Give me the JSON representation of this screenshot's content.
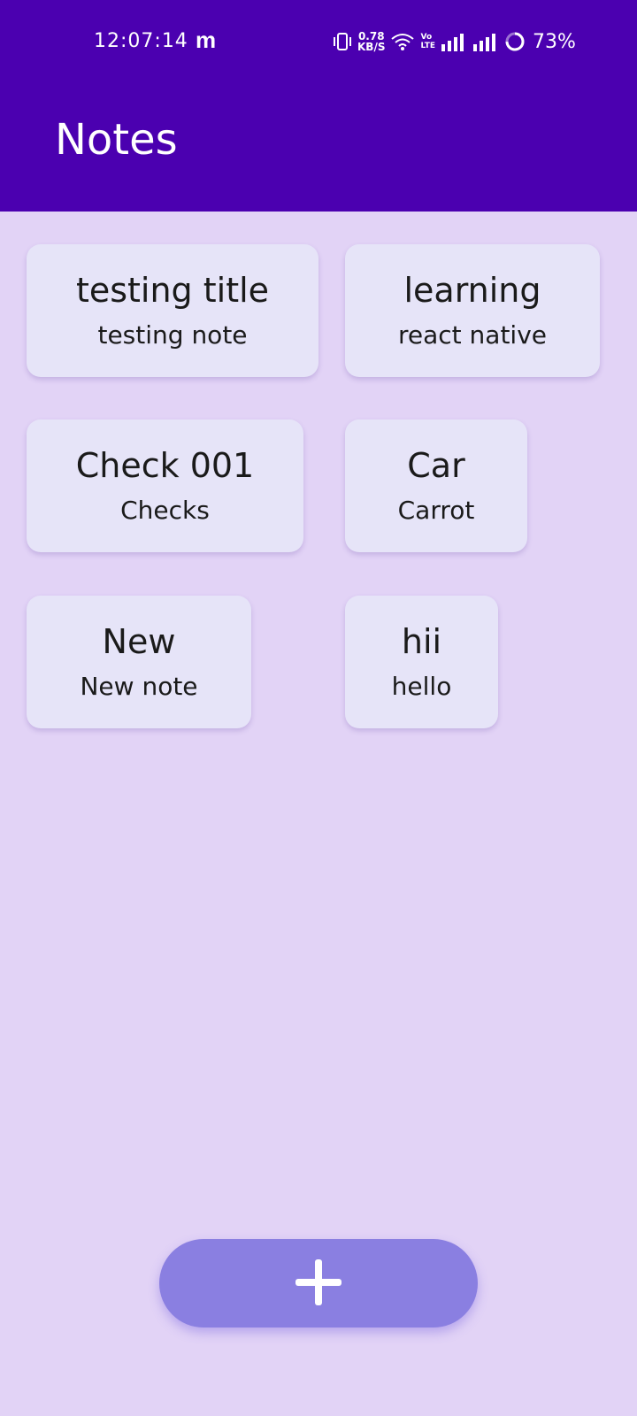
{
  "status_bar": {
    "time": "12:07:14",
    "carrier_glyph": "m",
    "net_speed_value": "0.78",
    "net_speed_unit": "KB/S",
    "volte_top": "Vo",
    "volte_bottom": "LTE",
    "battery": "73%",
    "icons": [
      "vibrate-icon",
      "wifi-icon",
      "signal-icon",
      "signal-icon",
      "battery-ring-icon"
    ]
  },
  "header": {
    "title": "Notes",
    "background_color": "#4b00b0"
  },
  "notes": [
    {
      "title": "testing title",
      "body": "testing note"
    },
    {
      "title": "learning",
      "body": "react native"
    },
    {
      "title": "Check 001",
      "body": "Checks"
    },
    {
      "title": "Car",
      "body": "Carrot"
    },
    {
      "title": "New",
      "body": "New note"
    },
    {
      "title": "hii",
      "body": "hello"
    }
  ],
  "add_button": {
    "icon": "plus-icon",
    "color": "#8a7fe1"
  },
  "colors": {
    "background": "#e2d3f6",
    "card": "#e6e4f8"
  }
}
